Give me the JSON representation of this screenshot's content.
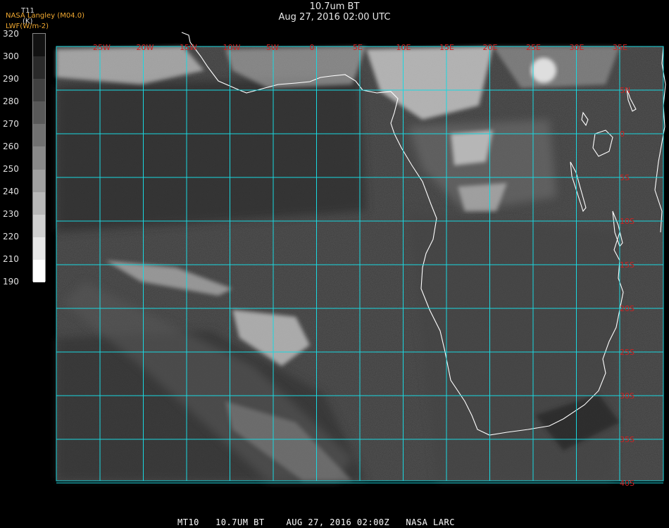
{
  "header": {
    "title": "10.7um BT",
    "datetime": "Aug 27, 2016 02:00 UTC"
  },
  "legend": {
    "org_label": "NASA Langley (M04.0)",
    "product_label": "LWF(W/m-2)",
    "param": "T11",
    "units": "(K)",
    "ticks": [
      "320",
      "300",
      "290",
      "280",
      "270",
      "260",
      "250",
      "240",
      "230",
      "220",
      "210",
      "190"
    ]
  },
  "map": {
    "lon_labels": [
      "25W",
      "20W",
      "15W",
      "10W",
      "5W",
      "0",
      "5E",
      "10E",
      "15E",
      "20E",
      "25E",
      "30E",
      "35E"
    ],
    "lat_labels": [
      "5N",
      "0",
      "5S",
      "10S",
      "15S",
      "20S",
      "25S",
      "30S",
      "35S",
      "40S"
    ],
    "grid_color": "#19d8e0",
    "label_color": "#cc2222",
    "coast_color": "#ffffff"
  },
  "footer": {
    "text": "MT10   10.7UM BT    AUG 27, 2016 02:00Z   NASA LARC"
  }
}
